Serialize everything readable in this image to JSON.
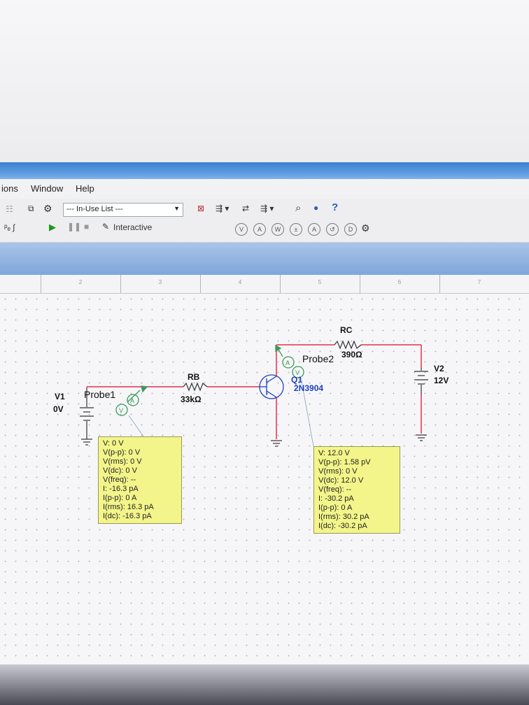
{
  "menu": {
    "items": [
      "ions",
      "Window",
      "Help"
    ]
  },
  "toolbar": {
    "inuse_list": "--- In-Use List ---",
    "interactive_label": "Interactive"
  },
  "ruler": {
    "labels": [
      "2",
      "3",
      "4",
      "5",
      "6",
      "7"
    ]
  },
  "circuit": {
    "v1": {
      "name": "V1",
      "value": "0V"
    },
    "v2": {
      "name": "V2",
      "value": "12V"
    },
    "rb": {
      "name": "RB",
      "value": "33kΩ"
    },
    "rc": {
      "name": "RC",
      "value": "390Ω"
    },
    "q1": {
      "name": "Q1",
      "part": "2N3904"
    },
    "probe1": {
      "name": "Probe1"
    },
    "probe2": {
      "name": "Probe2"
    }
  },
  "probe1_readout": [
    "V: 0 V",
    "V(p-p): 0 V",
    "V(rms): 0 V",
    "V(dc): 0 V",
    "V(freq): --",
    "I: -16.3 pA",
    "I(p-p): 0 A",
    "I(rms): 16.3 pA",
    "I(dc): -16.3 pA"
  ],
  "probe2_readout": [
    "V: 12.0 V",
    "V(p-p): 1.58 pV",
    "V(rms): 0 V",
    "V(dc): 12.0 V",
    "V(freq): --",
    "I: -30.2 pA",
    "I(p-p): 0 A",
    "I(rms): 30.2 pA",
    "I(dc): -30.2 pA"
  ]
}
